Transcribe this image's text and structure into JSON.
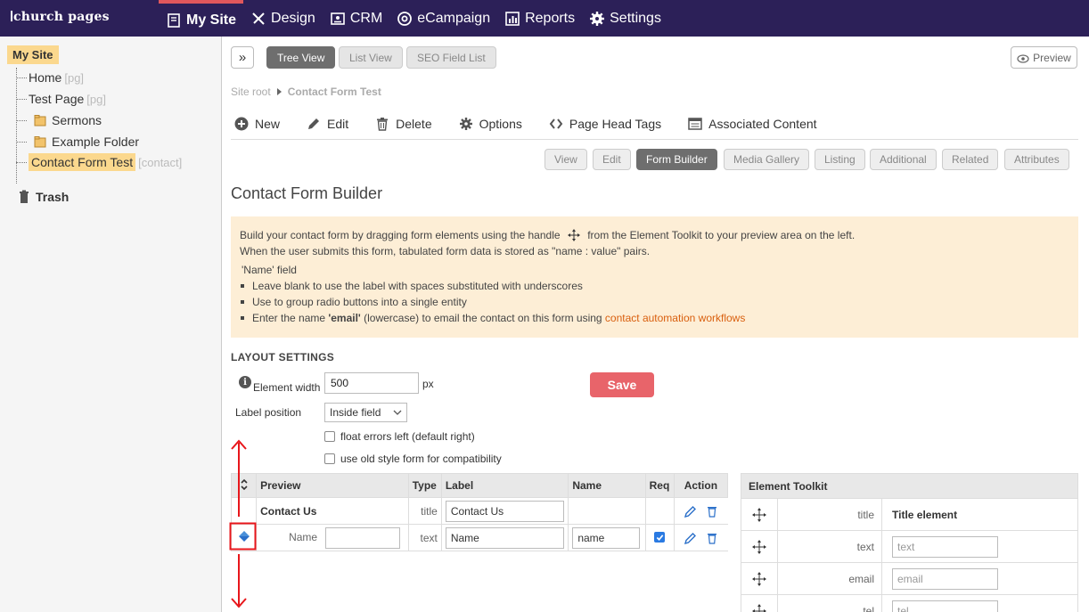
{
  "brand": "church pages",
  "nav": [
    {
      "label": "My Site",
      "icon": "page-icon",
      "active": true
    },
    {
      "label": "Design",
      "icon": "tools-icon"
    },
    {
      "label": "CRM",
      "icon": "contacts-icon"
    },
    {
      "label": "eCampaign",
      "icon": "at-icon"
    },
    {
      "label": "Reports",
      "icon": "chart-icon"
    },
    {
      "label": "Settings",
      "icon": "gear-icon"
    }
  ],
  "tree": {
    "root": "My Site",
    "nodes": [
      {
        "label": "Home",
        "suffix": "[pg]"
      },
      {
        "label": "Test Page",
        "suffix": "[pg]"
      },
      {
        "label": "Sermons",
        "suffix": ""
      },
      {
        "label": "Example Folder",
        "suffix": ""
      },
      {
        "label": "Contact Form Test",
        "suffix": "[contact]"
      }
    ],
    "trash": "Trash"
  },
  "view_tabs": [
    "Tree View",
    "List View",
    "SEO Field List"
  ],
  "preview": "Preview",
  "breadcrumb": {
    "root": "Site root",
    "current": "Contact Form Test"
  },
  "actions": [
    "New",
    "Edit",
    "Delete",
    "Options",
    "Page Head Tags",
    "Associated Content"
  ],
  "page_tabs": [
    "View",
    "Edit",
    "Form Builder",
    "Media Gallery",
    "Listing",
    "Additional",
    "Related",
    "Attributes"
  ],
  "page_title": "Contact Form Builder",
  "info": {
    "line1a": "Build your contact form by dragging form elements using the handle",
    "line1b": "from the Element Toolkit to your preview area on the left.",
    "line2": "When the user submits this form, tabulated form data is stored as \"name : value\" pairs.",
    "subhead": "'Name' field",
    "bullet1": "Leave blank to use the label with spaces substituted with underscores",
    "bullet2": "Use to group radio buttons into a single entity",
    "bullet3a": "Enter the name ",
    "bullet3b": "'email'",
    "bullet3c": " (lowercase) to email the contact on this form using ",
    "bullet3link": "contact automation workflows"
  },
  "layout": {
    "title": "LAYOUT SETTINGS",
    "width_label": "Element width",
    "width_value": "500",
    "width_unit": "px",
    "save": "Save",
    "label_position_label": "Label position",
    "label_position_value": "Inside field",
    "check1": "float errors left (default right)",
    "check2": "use old style form for compatibility"
  },
  "table": {
    "headers": [
      "Preview",
      "Type",
      "Label",
      "Name",
      "Req",
      "Action"
    ],
    "row1": {
      "preview": "Contact Us",
      "type": "title",
      "label": "Contact Us"
    },
    "row2": {
      "preview": "Name",
      "type": "text",
      "label": "Name",
      "name": "name"
    }
  },
  "toolkit": {
    "title": "Element Toolkit",
    "rows": [
      {
        "type": "title",
        "value": "Title element"
      },
      {
        "type": "text",
        "value": "text"
      },
      {
        "type": "email",
        "value": "email"
      },
      {
        "type": "tel",
        "value": "tel"
      }
    ]
  },
  "colors": {
    "nav_bg": "#2c2058",
    "active_accent": "#e0575c",
    "highlight": "#fbd88e",
    "save": "#e8646a",
    "info_bg": "#fdeed6",
    "link": "#d95f0e",
    "annotation": "#e8161b"
  }
}
